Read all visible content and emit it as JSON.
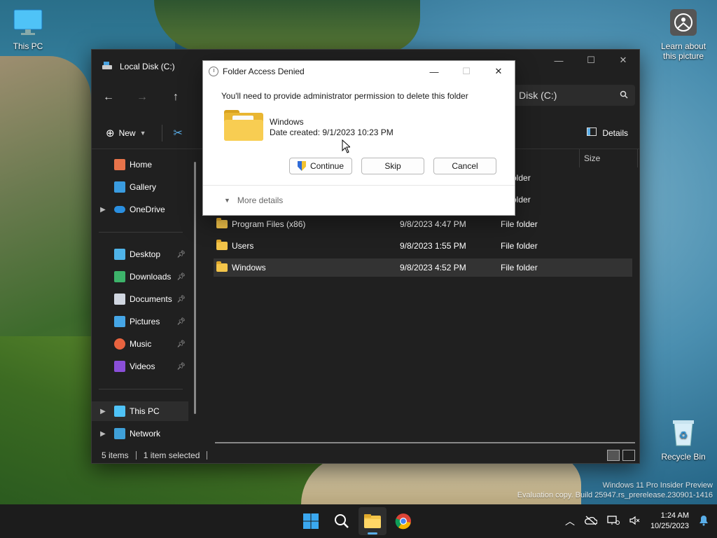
{
  "desktop": {
    "this_pc_label": "This PC",
    "learn_label": "Learn about this picture",
    "recycle_label": "Recycle Bin",
    "watermark_line1": "Windows 11 Pro Insider Preview",
    "watermark_line2": "Evaluation copy. Build 25947.rs_prerelease.230901-1416"
  },
  "explorer": {
    "title": "Local Disk (C:)",
    "address_text": "Disk (C:)",
    "new_label": "New",
    "details_label": "Details",
    "size_header": "Size",
    "sidebar": {
      "home": "Home",
      "gallery": "Gallery",
      "onedrive": "OneDrive",
      "desktop": "Desktop",
      "downloads": "Downloads",
      "documents": "Documents",
      "pictures": "Pictures",
      "music": "Music",
      "videos": "Videos",
      "this_pc": "This PC",
      "network": "Network"
    },
    "partial_type_1": "older",
    "partial_type_2": "older",
    "rows": [
      {
        "name": "Program Files (x86)",
        "date": "9/8/2023 4:47 PM",
        "type": "File folder"
      },
      {
        "name": "Users",
        "date": "9/8/2023 1:55 PM",
        "type": "File folder"
      },
      {
        "name": "Windows",
        "date": "9/8/2023 4:52 PM",
        "type": "File folder"
      }
    ],
    "status_items": "5 items",
    "status_selected": "1 item selected"
  },
  "dialog": {
    "title": "Folder Access Denied",
    "message": "You'll need to provide administrator permission to delete this folder",
    "folder_name": "Windows",
    "date_created": "Date created: 9/1/2023 10:23 PM",
    "continue_label": "Continue",
    "skip_label": "Skip",
    "cancel_label": "Cancel",
    "more_details_label": "More details"
  },
  "taskbar": {
    "time": "1:24 AM",
    "date": "10/25/2023"
  },
  "colors": {
    "accent": "#5aaee8",
    "folder": "#f4c54a"
  }
}
